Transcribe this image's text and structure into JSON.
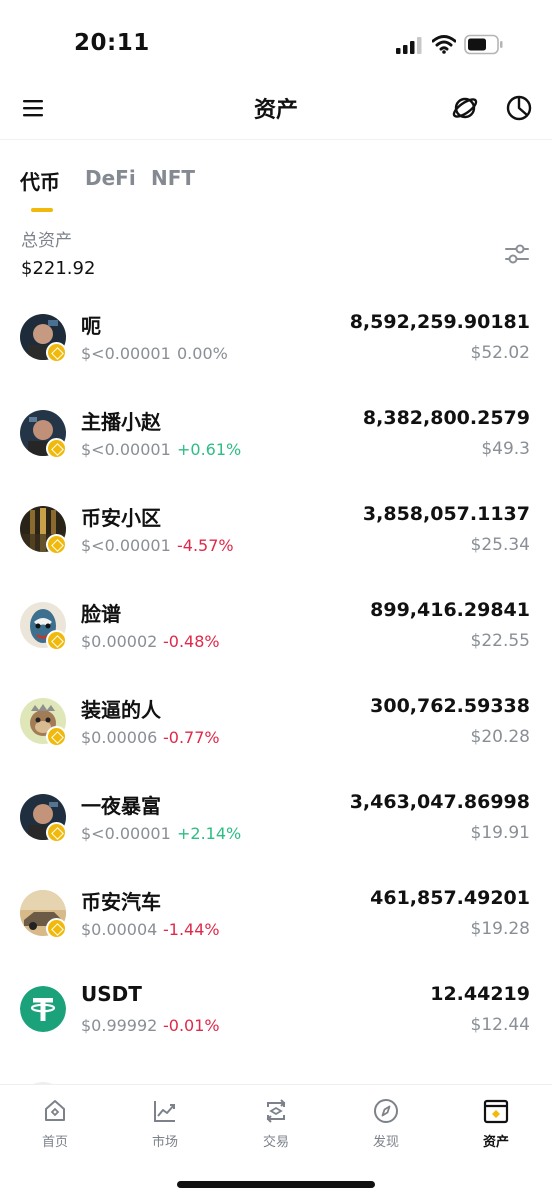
{
  "status": {
    "time": "20:11"
  },
  "header": {
    "title": "资产"
  },
  "tabs": [
    "代币",
    "DeFi",
    "NFT"
  ],
  "total": {
    "label": "总资产",
    "value": "$221.92"
  },
  "colors": {
    "accent": "#f0b90b",
    "up": "#2ebd85",
    "down": "#e0294a"
  },
  "assets": [
    {
      "name": "呃",
      "price": "$<0.00001",
      "change": "0.00%",
      "trend": "flat",
      "amount": "8,592,259.90181",
      "value": "$52.02"
    },
    {
      "name": "主播小赵",
      "price": "$<0.00001",
      "change": "+0.61%",
      "trend": "up",
      "amount": "8,382,800.2579",
      "value": "$49.3"
    },
    {
      "name": "币安小区",
      "price": "$<0.00001",
      "change": "-4.57%",
      "trend": "down",
      "amount": "3,858,057.1137",
      "value": "$25.34"
    },
    {
      "name": "脸谱",
      "price": "$0.00002",
      "change": "-0.48%",
      "trend": "down",
      "amount": "899,416.29841",
      "value": "$22.55"
    },
    {
      "name": "装逼的人",
      "price": "$0.00006",
      "change": "-0.77%",
      "trend": "down",
      "amount": "300,762.59338",
      "value": "$20.28"
    },
    {
      "name": "一夜暴富",
      "price": "$<0.00001",
      "change": "+2.14%",
      "trend": "up",
      "amount": "3,463,047.86998",
      "value": "$19.91"
    },
    {
      "name": "币安汽车",
      "price": "$0.00004",
      "change": "-1.44%",
      "trend": "down",
      "amount": "461,857.49201",
      "value": "$19.28"
    },
    {
      "name": "USDT",
      "price": "$0.99992",
      "change": "-0.01%",
      "trend": "down",
      "amount": "12.44219",
      "value": "$12.44"
    }
  ],
  "nav": [
    "首页",
    "市场",
    "交易",
    "发现",
    "资产"
  ]
}
